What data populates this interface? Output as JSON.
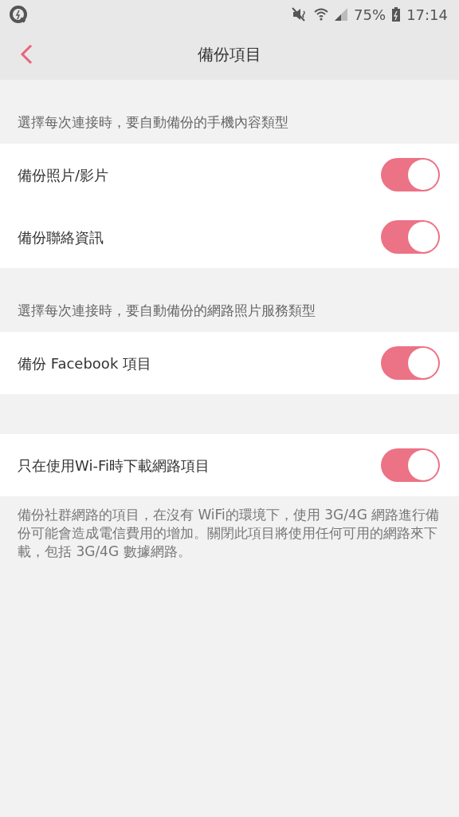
{
  "status_bar": {
    "battery": "75%",
    "time": "17:14"
  },
  "header": {
    "title": "備份項目"
  },
  "sections": [
    {
      "caption": "選擇每次連接時，要自動備份的手機內容類型",
      "rows": [
        {
          "label": "備份照片/影片",
          "on": true
        },
        {
          "label": "備份聯絡資訊",
          "on": true
        }
      ]
    },
    {
      "caption": "選擇每次連接時，要自動備份的網路照片服務類型",
      "rows": [
        {
          "label": "備份 Facebook 項目",
          "on": true
        }
      ]
    },
    {
      "rows": [
        {
          "label": "只在使用Wi-Fi時下載網路項目",
          "on": true
        }
      ]
    }
  ],
  "footnote": "備份社群網路的項目，在沒有 WiFi的環境下，使用 3G/4G 網路進行備份可能會造成電信費用的增加。關閉此項目將使用任何可用的網路來下載，包括 3G/4G 數據網路。"
}
